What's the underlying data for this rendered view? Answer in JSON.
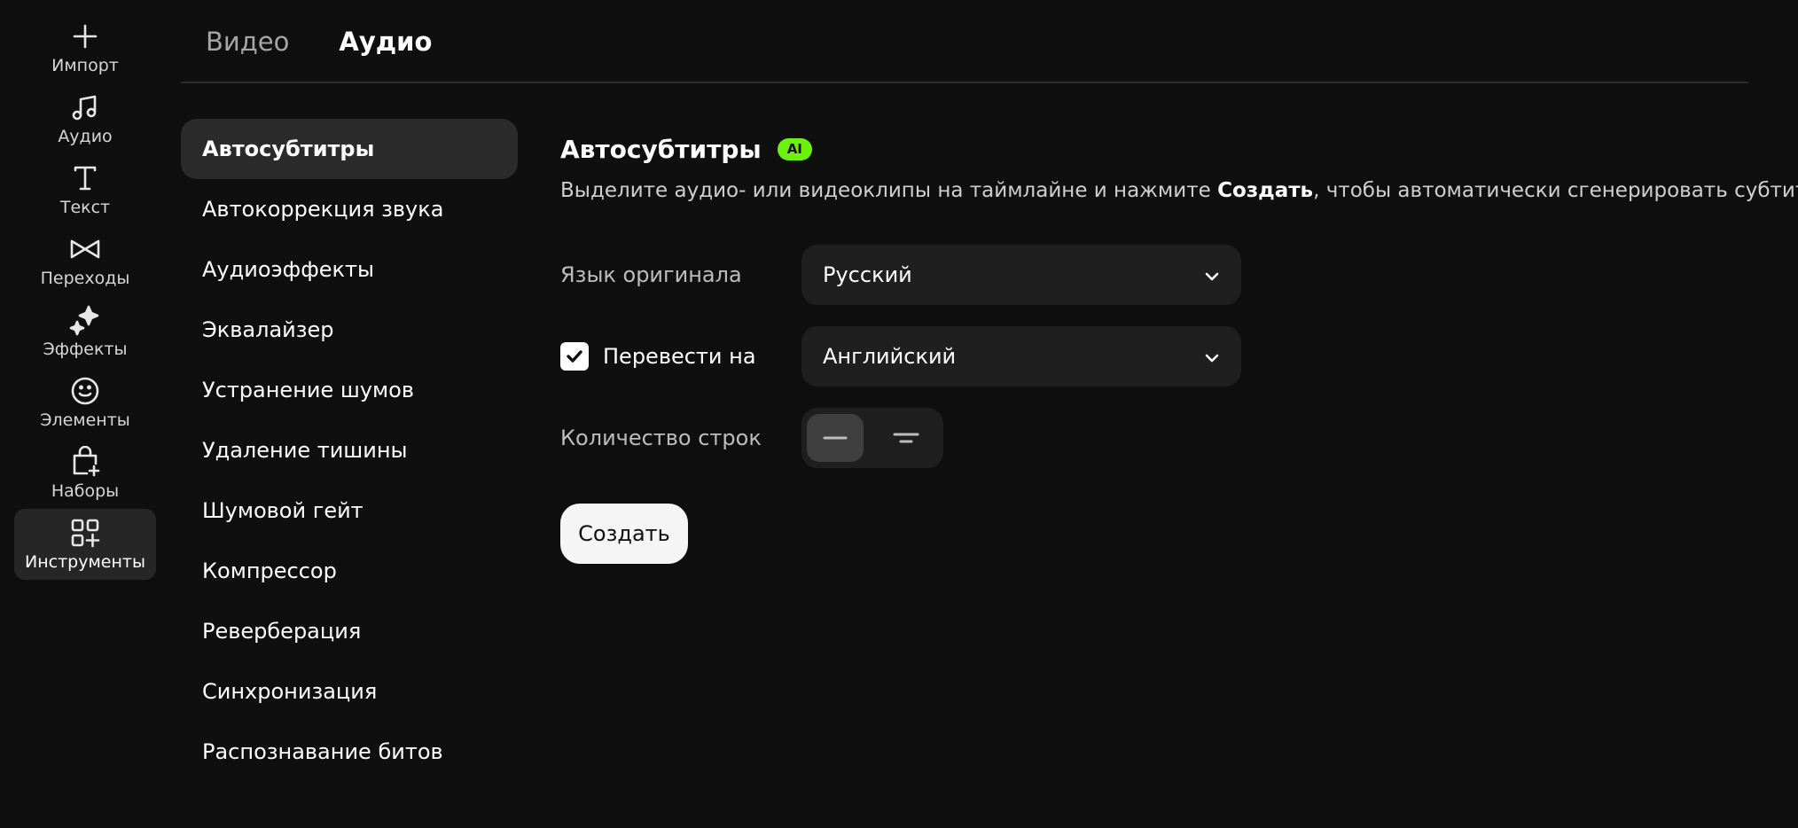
{
  "rail": {
    "items": [
      {
        "label": "Импорт",
        "icon": "plus-icon"
      },
      {
        "label": "Аудио",
        "icon": "music-note-icon"
      },
      {
        "label": "Текст",
        "icon": "text-icon"
      },
      {
        "label": "Переходы",
        "icon": "transition-icon"
      },
      {
        "label": "Эффекты",
        "icon": "sparkle-icon"
      },
      {
        "label": "Элементы",
        "icon": "smiley-icon"
      },
      {
        "label": "Наборы",
        "icon": "bag-plus-icon"
      },
      {
        "label": "Инструменты",
        "icon": "grid-plus-icon",
        "active": true
      }
    ]
  },
  "tabs": [
    {
      "label": "Видео",
      "active": false
    },
    {
      "label": "Аудио",
      "active": true
    }
  ],
  "tools": [
    {
      "label": "Автосубтитры",
      "active": true
    },
    {
      "label": "Автокоррекция звука"
    },
    {
      "label": "Аудиоэффекты"
    },
    {
      "label": "Эквалайзер"
    },
    {
      "label": "Устранение шумов"
    },
    {
      "label": "Удаление тишины"
    },
    {
      "label": "Шумовой гейт"
    },
    {
      "label": "Компрессор"
    },
    {
      "label": "Реверберация"
    },
    {
      "label": "Синхронизация"
    },
    {
      "label": "Распознавание битов"
    }
  ],
  "panel": {
    "title": "Автосубтитры",
    "badge": "AI",
    "desc_before": "Выделите аудио- или видеоклипы на таймлайне и нажмите ",
    "desc_bold": "Создать",
    "desc_after": ", чтобы автоматически сгенерировать субтитры",
    "language_label": "Язык оригинала",
    "language_value": "Русский",
    "translate_label": "Перевести на",
    "translate_checked": true,
    "translate_value": "Английский",
    "lines_label": "Количество строк",
    "lines_selected": 1,
    "create_label": "Создать"
  },
  "colors": {
    "background": "#0f0f0f",
    "accent_badge": "#6cf20c"
  }
}
